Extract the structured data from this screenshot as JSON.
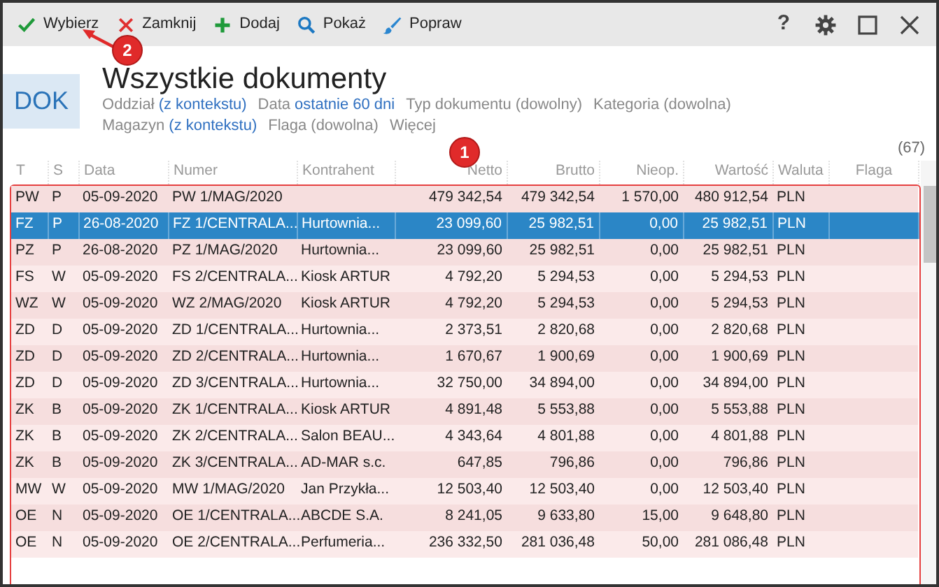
{
  "toolbar": {
    "buttons": [
      "Wybierz",
      "Zamknij",
      "Dodaj",
      "Pokaż",
      "Popraw"
    ],
    "window_controls": [
      {
        "label": "?",
        "kind": "help"
      },
      {
        "kind": "settings"
      },
      {
        "kind": "maximize"
      },
      {
        "kind": "close"
      }
    ]
  },
  "header": {
    "badge": "DOK",
    "title": "Wszystkie dokumenty",
    "filter_rows": [
      [
        {
          "label": "Oddział",
          "value": "(z kontekstu)",
          "set": true
        },
        {
          "label": "Data",
          "value": "ostatnie 60 dni",
          "set": true
        },
        {
          "label": "Typ dokumentu",
          "value": "(dowolny)",
          "set": false
        },
        {
          "label": "Kategoria",
          "value": "(dowolna)",
          "set": false
        }
      ],
      [
        {
          "label": "Magazyn",
          "value": "(z kontekstu)",
          "set": true
        },
        {
          "label": "Flaga",
          "value": "(dowolna)",
          "set": false
        },
        {
          "label": "Więcej"
        }
      ]
    ],
    "count": "(67)"
  },
  "table": {
    "columns": [
      "T",
      "S",
      "Data",
      "Numer",
      "Kontrahent",
      "Netto",
      "Brutto",
      "Nieop.",
      "Wartość",
      "Waluta",
      "Flaga"
    ],
    "rows": [
      {
        "t": "PW",
        "s": "P",
        "data": "05-09-2020",
        "numer": "PW 1/MAG/2020",
        "netto": "479 342,54",
        "brutto": "479 342,54",
        "nieop": "1 570,00",
        "wartosc": "480 912,54",
        "waluta": "PLN",
        "selected": false
      },
      {
        "t": "FZ",
        "s": "P",
        "data": "26-08-2020",
        "numer": "FZ 1/CENTRALA...",
        "kontrahent": "Hurtownia...",
        "netto": "23 099,60",
        "brutto": "25 982,51",
        "nieop": "0,00",
        "wartosc": "25 982,51",
        "waluta": "PLN",
        "selected": true
      },
      {
        "t": "PZ",
        "s": "P",
        "data": "26-08-2020",
        "numer": "PZ 1/MAG/2020",
        "kontrahent": "Hurtownia...",
        "netto": "23 099,60",
        "brutto": "25 982,51",
        "nieop": "0,00",
        "wartosc": "25 982,51",
        "waluta": "PLN",
        "selected": false
      },
      {
        "t": "FS",
        "s": "W",
        "data": "05-09-2020",
        "numer": "FS 2/CENTRALA...",
        "kontrahent": "Kiosk ARTUR",
        "netto": "4 792,20",
        "brutto": "5 294,53",
        "nieop": "0,00",
        "wartosc": "5 294,53",
        "waluta": "PLN",
        "selected": false
      },
      {
        "t": "WZ",
        "s": "W",
        "data": "05-09-2020",
        "numer": "WZ 2/MAG/2020",
        "kontrahent": "Kiosk ARTUR",
        "netto": "4 792,20",
        "brutto": "5 294,53",
        "nieop": "0,00",
        "wartosc": "5 294,53",
        "waluta": "PLN",
        "selected": false
      },
      {
        "t": "ZD",
        "s": "D",
        "data": "05-09-2020",
        "numer": "ZD 1/CENTRALA...",
        "kontrahent": "Hurtownia...",
        "netto": "2 373,51",
        "brutto": "2 820,68",
        "nieop": "0,00",
        "wartosc": "2 820,68",
        "waluta": "PLN",
        "selected": false
      },
      {
        "t": "ZD",
        "s": "D",
        "data": "05-09-2020",
        "numer": "ZD 2/CENTRALA...",
        "kontrahent": "Hurtownia...",
        "netto": "1 670,67",
        "brutto": "1 900,69",
        "nieop": "0,00",
        "wartosc": "1 900,69",
        "waluta": "PLN",
        "selected": false
      },
      {
        "t": "ZD",
        "s": "D",
        "data": "05-09-2020",
        "numer": "ZD 3/CENTRALA...",
        "kontrahent": "Hurtownia...",
        "netto": "32 750,00",
        "brutto": "34 894,00",
        "nieop": "0,00",
        "wartosc": "34 894,00",
        "waluta": "PLN",
        "selected": false
      },
      {
        "t": "ZK",
        "s": "B",
        "data": "05-09-2020",
        "numer": "ZK 1/CENTRALA...",
        "kontrahent": "Kiosk ARTUR",
        "netto": "4 891,48",
        "brutto": "5 553,88",
        "nieop": "0,00",
        "wartosc": "5 553,88",
        "waluta": "PLN",
        "selected": false
      },
      {
        "t": "ZK",
        "s": "B",
        "data": "05-09-2020",
        "numer": "ZK 2/CENTRALA...",
        "kontrahent": "Salon BEAU...",
        "netto": "4 343,64",
        "brutto": "4 801,88",
        "nieop": "0,00",
        "wartosc": "4 801,88",
        "waluta": "PLN",
        "selected": false
      },
      {
        "t": "ZK",
        "s": "B",
        "data": "05-09-2020",
        "numer": "ZK 3/CENTRALA...",
        "kontrahent": "AD-MAR s.c.",
        "netto": "647,85",
        "brutto": "796,86",
        "nieop": "0,00",
        "wartosc": "796,86",
        "waluta": "PLN",
        "selected": false
      },
      {
        "t": "MW",
        "s": "W",
        "data": "05-09-2020",
        "numer": "MW 1/MAG/2020",
        "kontrahent": "Jan Przykła...",
        "netto": "12 503,40",
        "brutto": "12 503,40",
        "nieop": "0,00",
        "wartosc": "12 503,40",
        "waluta": "PLN",
        "selected": false
      },
      {
        "t": "OE",
        "s": "N",
        "data": "05-09-2020",
        "numer": "OE 1/CENTRALA...",
        "kontrahent": "ABCDE S.A.",
        "netto": "8 241,05",
        "brutto": "9 633,80",
        "nieop": "15,00",
        "wartosc": "9 648,80",
        "waluta": "PLN",
        "selected": false
      },
      {
        "t": "OE",
        "s": "N",
        "data": "05-09-2020",
        "numer": "OE 2/CENTRALA...",
        "kontrahent": "Perfumeria...",
        "netto": "236 332,50",
        "brutto": "281 036,48",
        "nieop": "50,00",
        "wartosc": "281 086,48",
        "waluta": "PLN",
        "selected": false
      }
    ]
  },
  "annotations": [
    "1",
    "2"
  ]
}
